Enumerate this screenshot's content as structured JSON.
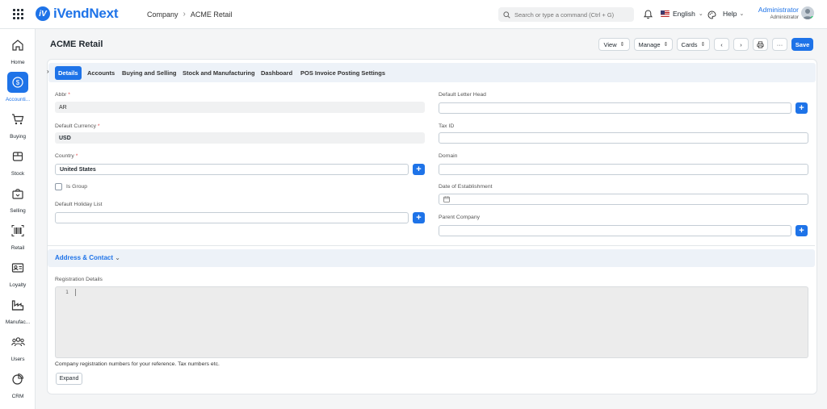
{
  "app": {
    "name": "iVendNext"
  },
  "breadcrumb": {
    "parent": "Company",
    "current": "ACME Retail"
  },
  "search": {
    "placeholder": "Search or type a command (Ctrl + G)"
  },
  "navbar": {
    "language": "English",
    "help": "Help",
    "user_name": "Administrator",
    "user_role": "Administrator"
  },
  "sidebar": {
    "items": [
      {
        "label": "Home",
        "icon": "home-icon"
      },
      {
        "label": "Accounti...",
        "icon": "dollar-icon",
        "active": true
      },
      {
        "label": "Buying",
        "icon": "cart-icon"
      },
      {
        "label": "Stock",
        "icon": "box-icon"
      },
      {
        "label": "Selling",
        "icon": "shopping-bag-icon"
      },
      {
        "label": "Retail",
        "icon": "barcode-icon"
      },
      {
        "label": "Loyalty",
        "icon": "id-card-icon"
      },
      {
        "label": "Manufac...",
        "icon": "factory-icon"
      },
      {
        "label": "Users",
        "icon": "users-icon"
      },
      {
        "label": "CRM",
        "icon": "pie-chart-icon"
      }
    ]
  },
  "page": {
    "title": "ACME Retail",
    "actions": {
      "view": "View",
      "manage": "Manage",
      "cards": "Cards",
      "save": "Save",
      "more": "···"
    }
  },
  "tabs": [
    "Details",
    "Accounts",
    "Buying and Selling",
    "Stock and Manufacturing",
    "Dashboard",
    "POS Invoice Posting Settings"
  ],
  "form": {
    "abbr": {
      "label": "Abbr",
      "value": "AR"
    },
    "default_currency": {
      "label": "Default Currency",
      "value": "USD"
    },
    "country": {
      "label": "Country",
      "value": "United States"
    },
    "is_group": {
      "label": "Is Group"
    },
    "default_holiday_list": {
      "label": "Default Holiday List",
      "value": ""
    },
    "default_letter_head": {
      "label": "Default Letter Head",
      "value": ""
    },
    "tax_id": {
      "label": "Tax ID",
      "value": ""
    },
    "domain": {
      "label": "Domain",
      "value": ""
    },
    "date_of_establishment": {
      "label": "Date of Establishment",
      "value": ""
    },
    "parent_company": {
      "label": "Parent Company",
      "value": ""
    },
    "required_mark": "*"
  },
  "address_section": {
    "title": "Address & Contact"
  },
  "registration": {
    "label": "Registration Details",
    "line_number": "1",
    "help": "Company registration numbers for your reference. Tax numbers etc.",
    "expand": "Expand"
  },
  "colors": {
    "primary": "#1e73e8",
    "required": "#e24c4c",
    "tab_bar": "#edf2f8"
  }
}
